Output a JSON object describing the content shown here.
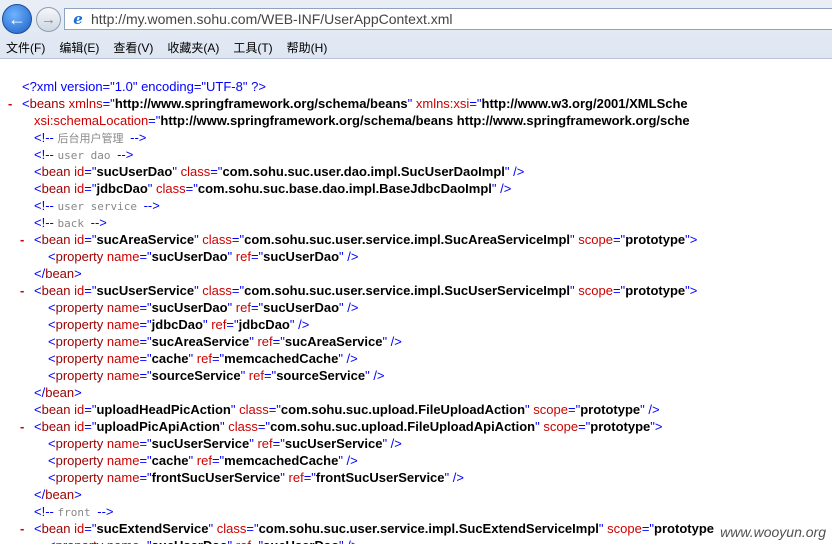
{
  "address_bar": {
    "url": "http://my.women.sohu.com/WEB-INF/UserAppContext.xml"
  },
  "menu": [
    "文件(F)",
    "编辑(E)",
    "查看(V)",
    "收藏夹(A)",
    "工具(T)",
    "帮助(H)"
  ],
  "xml_lines": [
    {
      "indent": 0,
      "toggle": "",
      "parts": [
        [
          "pi",
          "<?xml version=\"1.0\" encoding=\"UTF-8\" ?>"
        ]
      ]
    },
    {
      "indent": 0,
      "toggle": "-",
      "parts": [
        [
          "punct",
          "<"
        ],
        [
          "tag",
          "beans "
        ],
        [
          "attr",
          "xmlns"
        ],
        [
          "punct",
          "=\""
        ],
        [
          "val",
          "http://www.springframework.org/schema/beans"
        ],
        [
          "punct",
          "\" "
        ],
        [
          "attr",
          "xmlns:xsi"
        ],
        [
          "punct",
          "=\""
        ],
        [
          "val",
          "http://www.w3.org/2001/XMLSche"
        ]
      ]
    },
    {
      "indent": 1,
      "toggle": "",
      "parts": [
        [
          "attr",
          "xsi:schemaLocation"
        ],
        [
          "punct",
          "=\""
        ],
        [
          "val",
          "http://www.springframework.org/schema/beans http://www.springframework.org/sche"
        ]
      ]
    },
    {
      "indent": 1,
      "toggle": "",
      "parts": [
        [
          "cdelim",
          "<!-- "
        ],
        [
          "comment",
          " 后台用户管理  "
        ],
        [
          "cdelim",
          "-->"
        ]
      ]
    },
    {
      "indent": 1,
      "toggle": "",
      "parts": [
        [
          "cdelim",
          "<!-- "
        ],
        [
          "comment",
          " user dao  "
        ],
        [
          "cdelim",
          "-->"
        ]
      ]
    },
    {
      "indent": 1,
      "toggle": "",
      "parts": [
        [
          "punct",
          "<"
        ],
        [
          "tag",
          "bean "
        ],
        [
          "attr",
          "id"
        ],
        [
          "punct",
          "=\""
        ],
        [
          "val",
          "sucUserDao"
        ],
        [
          "punct",
          "\" "
        ],
        [
          "attr",
          "class"
        ],
        [
          "punct",
          "=\""
        ],
        [
          "val",
          "com.sohu.suc.user.dao.impl.SucUserDaoImpl"
        ],
        [
          "punct",
          "\" />"
        ]
      ]
    },
    {
      "indent": 1,
      "toggle": "",
      "parts": [
        [
          "punct",
          "<"
        ],
        [
          "tag",
          "bean "
        ],
        [
          "attr",
          "id"
        ],
        [
          "punct",
          "=\""
        ],
        [
          "val",
          "jdbcDao"
        ],
        [
          "punct",
          "\" "
        ],
        [
          "attr",
          "class"
        ],
        [
          "punct",
          "=\""
        ],
        [
          "val",
          "com.sohu.suc.base.dao.impl.BaseJdbcDaoImpl"
        ],
        [
          "punct",
          "\" />"
        ]
      ]
    },
    {
      "indent": 1,
      "toggle": "",
      "parts": [
        [
          "cdelim",
          "<!-- "
        ],
        [
          "comment",
          " user service  "
        ],
        [
          "cdelim",
          "-->"
        ]
      ]
    },
    {
      "indent": 1,
      "toggle": "",
      "parts": [
        [
          "cdelim",
          "<!-- "
        ],
        [
          "comment",
          " back  "
        ],
        [
          "cdelim",
          "-->"
        ]
      ]
    },
    {
      "indent": 1,
      "toggle": "-",
      "parts": [
        [
          "punct",
          "<"
        ],
        [
          "tag",
          "bean "
        ],
        [
          "attr",
          "id"
        ],
        [
          "punct",
          "=\""
        ],
        [
          "val",
          "sucAreaService"
        ],
        [
          "punct",
          "\" "
        ],
        [
          "attr",
          "class"
        ],
        [
          "punct",
          "=\""
        ],
        [
          "val",
          "com.sohu.suc.user.service.impl.SucAreaServiceImpl"
        ],
        [
          "punct",
          "\" "
        ],
        [
          "attr",
          "scope"
        ],
        [
          "punct",
          "=\""
        ],
        [
          "val",
          "prototype"
        ],
        [
          "punct",
          "\">"
        ]
      ]
    },
    {
      "indent": 2,
      "toggle": "",
      "parts": [
        [
          "punct",
          "<"
        ],
        [
          "tag",
          "property "
        ],
        [
          "attr",
          "name"
        ],
        [
          "punct",
          "=\""
        ],
        [
          "val",
          "sucUserDao"
        ],
        [
          "punct",
          "\" "
        ],
        [
          "attr",
          "ref"
        ],
        [
          "punct",
          "=\""
        ],
        [
          "val",
          "sucUserDao"
        ],
        [
          "punct",
          "\" />"
        ]
      ]
    },
    {
      "indent": 1,
      "toggle": "",
      "parts": [
        [
          "punct",
          "</"
        ],
        [
          "tag",
          "bean"
        ],
        [
          "punct",
          ">"
        ]
      ]
    },
    {
      "indent": 1,
      "toggle": "-",
      "parts": [
        [
          "punct",
          "<"
        ],
        [
          "tag",
          "bean "
        ],
        [
          "attr",
          "id"
        ],
        [
          "punct",
          "=\""
        ],
        [
          "val",
          "sucUserService"
        ],
        [
          "punct",
          "\" "
        ],
        [
          "attr",
          "class"
        ],
        [
          "punct",
          "=\""
        ],
        [
          "val",
          "com.sohu.suc.user.service.impl.SucUserServiceImpl"
        ],
        [
          "punct",
          "\" "
        ],
        [
          "attr",
          "scope"
        ],
        [
          "punct",
          "=\""
        ],
        [
          "val",
          "prototype"
        ],
        [
          "punct",
          "\">"
        ]
      ]
    },
    {
      "indent": 2,
      "toggle": "",
      "parts": [
        [
          "punct",
          "<"
        ],
        [
          "tag",
          "property "
        ],
        [
          "attr",
          "name"
        ],
        [
          "punct",
          "=\""
        ],
        [
          "val",
          "sucUserDao"
        ],
        [
          "punct",
          "\" "
        ],
        [
          "attr",
          "ref"
        ],
        [
          "punct",
          "=\""
        ],
        [
          "val",
          "sucUserDao"
        ],
        [
          "punct",
          "\" />"
        ]
      ]
    },
    {
      "indent": 2,
      "toggle": "",
      "parts": [
        [
          "punct",
          "<"
        ],
        [
          "tag",
          "property "
        ],
        [
          "attr",
          "name"
        ],
        [
          "punct",
          "=\""
        ],
        [
          "val",
          "jdbcDao"
        ],
        [
          "punct",
          "\" "
        ],
        [
          "attr",
          "ref"
        ],
        [
          "punct",
          "=\""
        ],
        [
          "val",
          "jdbcDao"
        ],
        [
          "punct",
          "\" />"
        ]
      ]
    },
    {
      "indent": 2,
      "toggle": "",
      "parts": [
        [
          "punct",
          "<"
        ],
        [
          "tag",
          "property "
        ],
        [
          "attr",
          "name"
        ],
        [
          "punct",
          "=\""
        ],
        [
          "val",
          "sucAreaService"
        ],
        [
          "punct",
          "\" "
        ],
        [
          "attr",
          "ref"
        ],
        [
          "punct",
          "=\""
        ],
        [
          "val",
          "sucAreaService"
        ],
        [
          "punct",
          "\" />"
        ]
      ]
    },
    {
      "indent": 2,
      "toggle": "",
      "parts": [
        [
          "punct",
          "<"
        ],
        [
          "tag",
          "property "
        ],
        [
          "attr",
          "name"
        ],
        [
          "punct",
          "=\""
        ],
        [
          "val",
          "cache"
        ],
        [
          "punct",
          "\" "
        ],
        [
          "attr",
          "ref"
        ],
        [
          "punct",
          "=\""
        ],
        [
          "val",
          "memcachedCache"
        ],
        [
          "punct",
          "\" />"
        ]
      ]
    },
    {
      "indent": 2,
      "toggle": "",
      "parts": [
        [
          "punct",
          "<"
        ],
        [
          "tag",
          "property "
        ],
        [
          "attr",
          "name"
        ],
        [
          "punct",
          "=\""
        ],
        [
          "val",
          "sourceService"
        ],
        [
          "punct",
          "\" "
        ],
        [
          "attr",
          "ref"
        ],
        [
          "punct",
          "=\""
        ],
        [
          "val",
          "sourceService"
        ],
        [
          "punct",
          "\" />"
        ]
      ]
    },
    {
      "indent": 1,
      "toggle": "",
      "parts": [
        [
          "punct",
          "</"
        ],
        [
          "tag",
          "bean"
        ],
        [
          "punct",
          ">"
        ]
      ]
    },
    {
      "indent": 1,
      "toggle": "",
      "parts": [
        [
          "punct",
          "<"
        ],
        [
          "tag",
          "bean "
        ],
        [
          "attr",
          "id"
        ],
        [
          "punct",
          "=\""
        ],
        [
          "val",
          "uploadHeadPicAction"
        ],
        [
          "punct",
          "\" "
        ],
        [
          "attr",
          "class"
        ],
        [
          "punct",
          "=\""
        ],
        [
          "val",
          "com.sohu.suc.upload.FileUploadAction"
        ],
        [
          "punct",
          "\" "
        ],
        [
          "attr",
          "scope"
        ],
        [
          "punct",
          "=\""
        ],
        [
          "val",
          "prototype"
        ],
        [
          "punct",
          "\" />"
        ]
      ]
    },
    {
      "indent": 1,
      "toggle": "-",
      "parts": [
        [
          "punct",
          "<"
        ],
        [
          "tag",
          "bean "
        ],
        [
          "attr",
          "id"
        ],
        [
          "punct",
          "=\""
        ],
        [
          "val",
          "uploadPicApiAction"
        ],
        [
          "punct",
          "\" "
        ],
        [
          "attr",
          "class"
        ],
        [
          "punct",
          "=\""
        ],
        [
          "val",
          "com.sohu.suc.upload.FileUploadApiAction"
        ],
        [
          "punct",
          "\" "
        ],
        [
          "attr",
          "scope"
        ],
        [
          "punct",
          "=\""
        ],
        [
          "val",
          "prototype"
        ],
        [
          "punct",
          "\">"
        ]
      ]
    },
    {
      "indent": 2,
      "toggle": "",
      "parts": [
        [
          "punct",
          "<"
        ],
        [
          "tag",
          "property "
        ],
        [
          "attr",
          "name"
        ],
        [
          "punct",
          "=\""
        ],
        [
          "val",
          "sucUserService"
        ],
        [
          "punct",
          "\" "
        ],
        [
          "attr",
          "ref"
        ],
        [
          "punct",
          "=\""
        ],
        [
          "val",
          "sucUserService"
        ],
        [
          "punct",
          "\" />"
        ]
      ]
    },
    {
      "indent": 2,
      "toggle": "",
      "parts": [
        [
          "punct",
          "<"
        ],
        [
          "tag",
          "property "
        ],
        [
          "attr",
          "name"
        ],
        [
          "punct",
          "=\""
        ],
        [
          "val",
          "cache"
        ],
        [
          "punct",
          "\" "
        ],
        [
          "attr",
          "ref"
        ],
        [
          "punct",
          "=\""
        ],
        [
          "val",
          "memcachedCache"
        ],
        [
          "punct",
          "\" />"
        ]
      ]
    },
    {
      "indent": 2,
      "toggle": "",
      "parts": [
        [
          "punct",
          "<"
        ],
        [
          "tag",
          "property "
        ],
        [
          "attr",
          "name"
        ],
        [
          "punct",
          "=\""
        ],
        [
          "val",
          "frontSucUserService"
        ],
        [
          "punct",
          "\" "
        ],
        [
          "attr",
          "ref"
        ],
        [
          "punct",
          "=\""
        ],
        [
          "val",
          "frontSucUserService"
        ],
        [
          "punct",
          "\" />"
        ]
      ]
    },
    {
      "indent": 1,
      "toggle": "",
      "parts": [
        [
          "punct",
          "</"
        ],
        [
          "tag",
          "bean"
        ],
        [
          "punct",
          ">"
        ]
      ]
    },
    {
      "indent": 1,
      "toggle": "",
      "parts": [
        [
          "cdelim",
          "<!-- "
        ],
        [
          "comment",
          " front  "
        ],
        [
          "cdelim",
          "-->"
        ]
      ]
    },
    {
      "indent": 1,
      "toggle": "-",
      "parts": [
        [
          "punct",
          "<"
        ],
        [
          "tag",
          "bean "
        ],
        [
          "attr",
          "id"
        ],
        [
          "punct",
          "=\""
        ],
        [
          "val",
          "sucExtendService"
        ],
        [
          "punct",
          "\" "
        ],
        [
          "attr",
          "class"
        ],
        [
          "punct",
          "=\""
        ],
        [
          "val",
          "com.sohu.suc.user.service.impl.SucExtendServiceImpl"
        ],
        [
          "punct",
          "\" "
        ],
        [
          "attr",
          "scope"
        ],
        [
          "punct",
          "=\""
        ],
        [
          "val",
          "prototype"
        ]
      ]
    },
    {
      "indent": 2,
      "toggle": "",
      "parts": [
        [
          "punct",
          "<"
        ],
        [
          "tag",
          "property "
        ],
        [
          "attr",
          "name"
        ],
        [
          "punct",
          "=\""
        ],
        [
          "val",
          "sucUserDao"
        ],
        [
          "punct",
          "\" "
        ],
        [
          "attr",
          "ref"
        ],
        [
          "punct",
          "=\""
        ],
        [
          "val",
          "sucUserDao"
        ],
        [
          "punct",
          "\" />"
        ]
      ]
    }
  ],
  "watermark": "www.wooyun.org"
}
